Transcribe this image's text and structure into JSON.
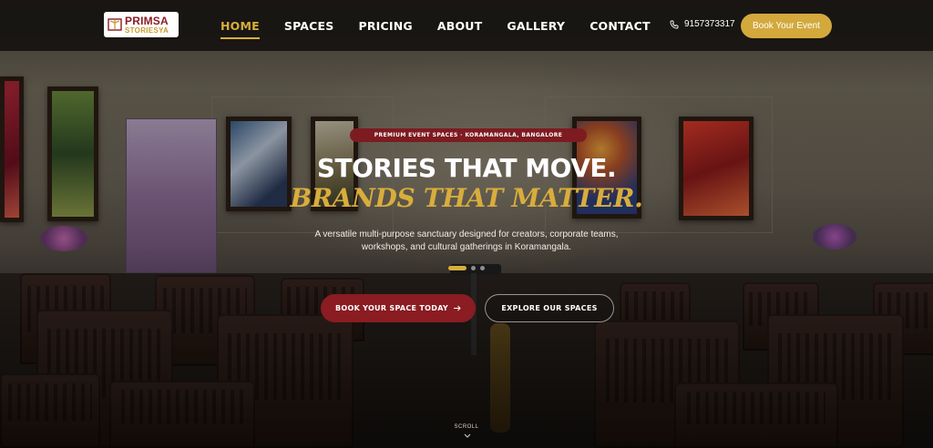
{
  "brand": {
    "line1": "PRIMSA",
    "line2": "STORIESYA"
  },
  "nav": {
    "items": [
      {
        "label": "HOME",
        "active": true
      },
      {
        "label": "SPACES",
        "active": false
      },
      {
        "label": "PRICING",
        "active": false
      },
      {
        "label": "ABOUT",
        "active": false
      },
      {
        "label": "GALLERY",
        "active": false
      },
      {
        "label": "CONTACT",
        "active": false
      }
    ]
  },
  "header": {
    "phone": "9157373317",
    "phone_icon": "phone-icon",
    "cta_label": "Book Your Event"
  },
  "hero": {
    "badge": "PREMIUM EVENT SPACES · KORAMANGALA, BANGALORE",
    "title_line1": "STORIES THAT MOVE.",
    "title_line2": "BRANDS THAT MATTER.",
    "subtitle": "A versatile multi-purpose sanctuary designed for creators, corporate teams, workshops, and cultural gatherings in Koramangala.",
    "slides": {
      "count": 3,
      "active_index": 0
    },
    "primary_cta": "BOOK YOUR SPACE TODAY",
    "primary_cta_icon": "arrow-right-icon",
    "secondary_cta": "EXPLORE OUR SPACES",
    "scroll_label": "SCROLL"
  },
  "colors": {
    "accent_gold": "#d9ad3c",
    "button_gold": "#d3a93d",
    "brand_red": "#8a1c22",
    "header_bg": "#161310"
  }
}
